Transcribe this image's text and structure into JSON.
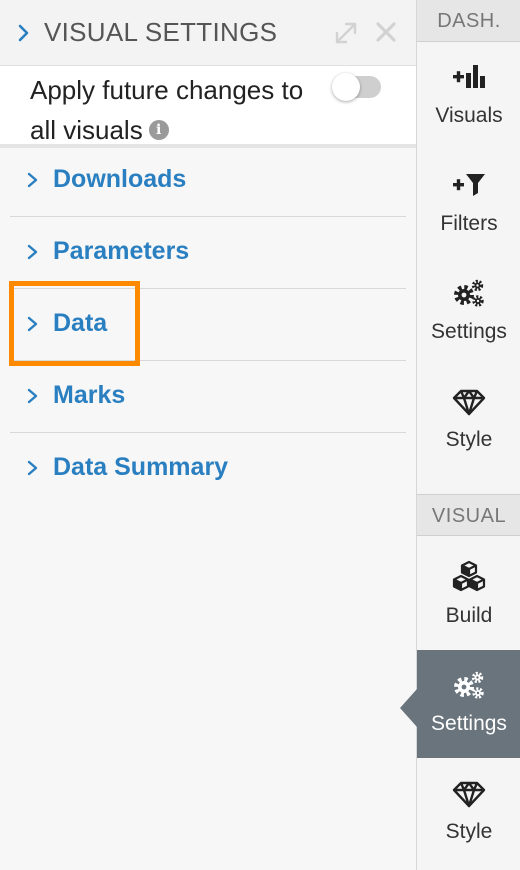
{
  "panel": {
    "title": "VISUAL SETTINGS",
    "apply_label": "Apply future changes to all visuals",
    "apply_toggle_on": false,
    "sections": [
      {
        "label": "Downloads"
      },
      {
        "label": "Parameters"
      },
      {
        "label": "Data",
        "highlighted": true
      },
      {
        "label": "Marks"
      },
      {
        "label": "Data Summary"
      }
    ]
  },
  "rail": {
    "dashboard_header": "DASH.",
    "dashboard_items": [
      {
        "label": "Visuals",
        "icon": "add-visual-icon"
      },
      {
        "label": "Filters",
        "icon": "add-filter-icon"
      },
      {
        "label": "Settings",
        "icon": "gears-icon"
      },
      {
        "label": "Style",
        "icon": "diamond-icon"
      }
    ],
    "visual_header": "VISUAL",
    "visual_items": [
      {
        "label": "Build",
        "icon": "cubes-icon"
      },
      {
        "label": "Settings",
        "icon": "gears-icon",
        "active": true
      },
      {
        "label": "Style",
        "icon": "diamond-icon"
      }
    ]
  },
  "colors": {
    "link_blue": "#2a7fc1",
    "highlight_orange": "#ff8a00",
    "active_rail_bg": "#69747d"
  }
}
